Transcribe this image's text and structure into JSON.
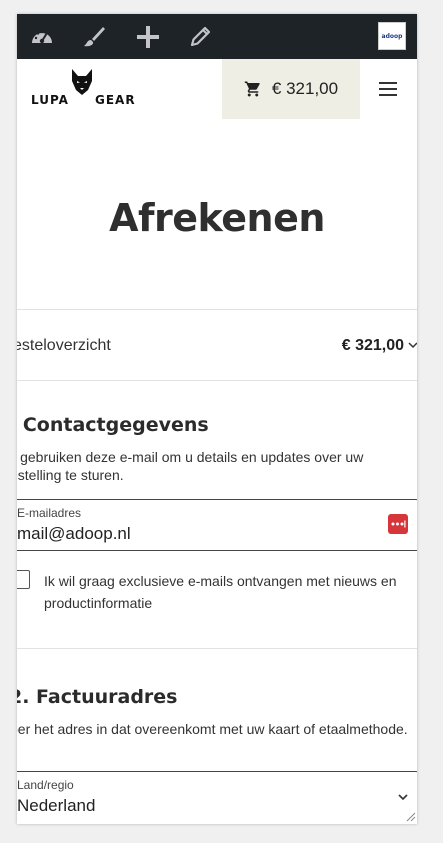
{
  "admin_bar": {
    "icons": [
      "dashboard-gauge-icon",
      "customize-brush-icon",
      "plus-icon",
      "edit-pencil-icon"
    ],
    "site_logo_text": "adoop",
    "background": "#1d2327",
    "icon_color": "#c3c4c7"
  },
  "header": {
    "brand": {
      "word1": "LUPA",
      "word2": "GEAR"
    },
    "cart": {
      "total": "€ 321,00",
      "icon": "cart-icon",
      "background": "#eeeee5"
    },
    "menu_icon": "hamburger-menu-icon"
  },
  "checkout": {
    "title": "Afrekenen",
    "order_summary": {
      "label": "esteloverzicht",
      "total": "€ 321,00"
    },
    "contact": {
      "heading": ". Contactgegevens",
      "description": "ij gebruiken deze e-mail om u details en updates over uw estelling te sturen.",
      "email_label": "E-mailadres",
      "email_value": "mail@adoop.nl",
      "newsletter_label": "Ik wil graag exclusieve e-mails ontvangen met nieuws en productinformatie",
      "newsletter_checked": false
    },
    "billing": {
      "heading": "2. Factuuradres",
      "description": "oer het adres in dat overeenkomt met uw kaart of etaalmethode.",
      "country_label": "Land/regio",
      "country_value": "Nederland"
    }
  },
  "colors": {
    "password_manager_icon": "#d6363a",
    "title_text": "#2f2f2f"
  }
}
